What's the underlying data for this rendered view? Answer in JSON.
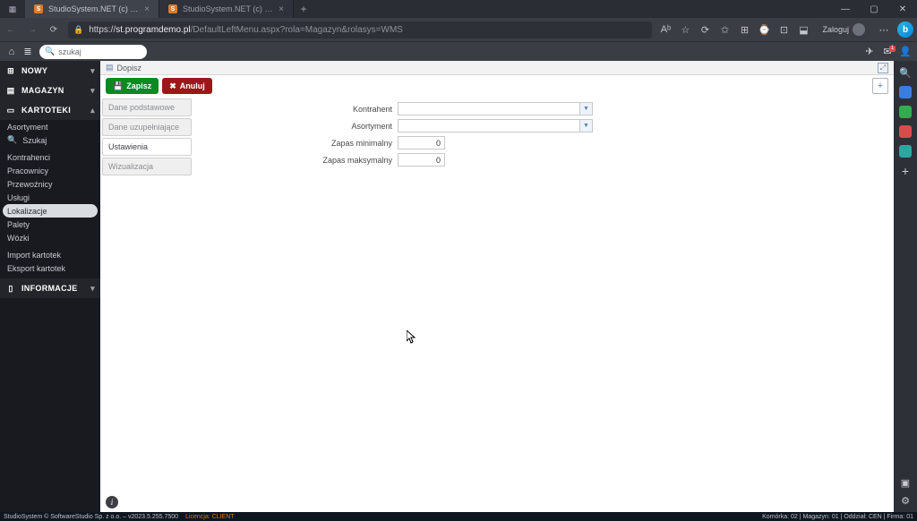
{
  "browser": {
    "tab1": "StudioSystem.NET (c) SoftwareS…",
    "tab2": "StudioSystem.NET (c) SoftwareS…",
    "url_host": "st.programdemo.pl",
    "url_path": "/DefaultLeftMenu.aspx?rola=Magazyn&rolasys=WMS",
    "login": "Zaloguj"
  },
  "subtb": {
    "search_placeholder": "szukaj"
  },
  "sidebar": {
    "nowy": "NOWY",
    "magazyn": "MAGAZYN",
    "kartoteki": "KARTOTEKI",
    "informacje": "INFORMACJE",
    "items": [
      "Asortyment",
      "Szukaj",
      "Kontrahenci",
      "Pracownicy",
      "Przewoźnicy",
      "Usługi",
      "Lokalizacje",
      "Palety",
      "Wózki",
      "Import kartotek",
      "Eksport kartotek"
    ]
  },
  "content": {
    "header": "Dopisz",
    "save": "Zapisz",
    "cancel": "Anuluj",
    "tabs": [
      "Dane podstawowe",
      "Dane uzupełniające",
      "Ustawienia",
      "Wizualizacja"
    ],
    "form": {
      "kontrahent_label": "Kontrahent",
      "asortyment_label": "Asortyment",
      "zapas_min_label": "Zapas minimalny",
      "zapas_min_value": "0",
      "zapas_max_label": "Zapas maksymalny",
      "zapas_max_value": "0"
    }
  },
  "status": {
    "left": "StudioSystem © SoftwareStudio Sp. z o.o. – v2023.5.255.7500",
    "license": "Licencja: CLIENT",
    "right": "Komórka: 02 | Magazyn: 01 | Oddział: CEN | Firma: 01"
  }
}
